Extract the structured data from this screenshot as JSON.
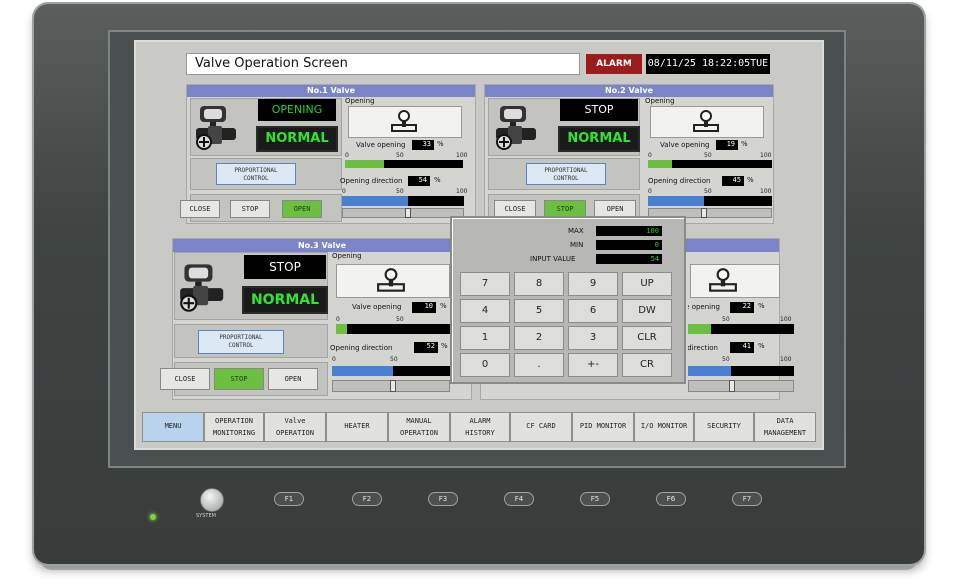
{
  "screen": {
    "title": "Valve Operation Screen",
    "alarm_label": "ALARM",
    "clock": "08/11/25 18:22:05TUE"
  },
  "valves": [
    {
      "title": "No.1 Valve",
      "state": "OPENING",
      "state_color": "#2ed22e",
      "health": "NORMAL",
      "control_label_1": "PROPORTIONAL",
      "control_label_2": "CONTROL",
      "opening_label": "Opening",
      "valve_opening_label": "Valve opening",
      "valve_opening_value": "33",
      "valve_opening_unit": "%",
      "valve_opening_fraction": 0.33,
      "direction_label": "Opening direction",
      "direction_value": "54",
      "direction_unit": "%",
      "direction_fraction": 0.54,
      "scale_min": "0",
      "scale_mid": "50",
      "scale_max": "100",
      "buttons": [
        "CLOSE",
        "STOP",
        "OPEN"
      ],
      "active_button": "OPEN"
    },
    {
      "title": "No.2 Valve",
      "state": "STOP",
      "state_color": "#ffffff",
      "health": "NORMAL",
      "control_label_1": "PROPORTIONAL",
      "control_label_2": "CONTROL",
      "opening_label": "Opening",
      "valve_opening_label": "Valve opening",
      "valve_opening_value": "19",
      "valve_opening_unit": "%",
      "valve_opening_fraction": 0.19,
      "direction_label": "Opening direction",
      "direction_value": "45",
      "direction_unit": "%",
      "direction_fraction": 0.45,
      "scale_min": "0",
      "scale_mid": "50",
      "scale_max": "100",
      "buttons": [
        "CLOSE",
        "STOP",
        "OPEN"
      ],
      "active_button": "STOP"
    },
    {
      "title": "No.3 Valve",
      "state": "STOP",
      "state_color": "#ffffff",
      "health": "NORMAL",
      "control_label_1": "PROPORTIONAL",
      "control_label_2": "CONTROL",
      "opening_label": "Opening",
      "valve_opening_label": "Valve opening",
      "valve_opening_value": "10",
      "valve_opening_unit": "%",
      "valve_opening_fraction": 0.1,
      "direction_label": "Opening direction",
      "direction_value": "52",
      "direction_unit": "%",
      "direction_fraction": 0.52,
      "scale_min": "0",
      "scale_mid": "50",
      "scale_max": "100",
      "buttons": [
        "CLOSE",
        "STOP",
        "OPEN"
      ],
      "active_button": "STOP"
    },
    {
      "title": "",
      "valve_opening_label": "Valve opening",
      "valve_opening_value": "22",
      "valve_opening_unit": "%",
      "valve_opening_fraction": 0.22,
      "direction_label": "Opening direction",
      "direction_value": "41",
      "direction_unit": "%",
      "direction_fraction": 0.41,
      "scale_mid": "50",
      "scale_max": "100"
    }
  ],
  "keypad": {
    "max_label": "MAX",
    "max_value": "100",
    "min_label": "MIN",
    "min_value": "0",
    "input_label": "INPUT VALUE",
    "input_value": "54",
    "keys": [
      "7",
      "8",
      "9",
      "UP",
      "4",
      "5",
      "6",
      "DW",
      "1",
      "2",
      "3",
      "CLR",
      "0",
      ".",
      "+-",
      "CR"
    ]
  },
  "menu": [
    {
      "line1": "MENU",
      "line2": ""
    },
    {
      "line1": "OPERATION",
      "line2": "MONITORING"
    },
    {
      "line1": "Valve",
      "line2": "OPERATION"
    },
    {
      "line1": "HEATER",
      "line2": ""
    },
    {
      "line1": "MANUAL",
      "line2": "OPERATION"
    },
    {
      "line1": "ALARM",
      "line2": "HISTORY"
    },
    {
      "line1": "CF CARD",
      "line2": ""
    },
    {
      "line1": "PID MONITOR",
      "line2": ""
    },
    {
      "line1": "I/O MONITOR",
      "line2": ""
    },
    {
      "line1": "SECURITY",
      "line2": ""
    },
    {
      "line1": "DATA",
      "line2": "MANAGEMENT"
    }
  ],
  "hardware": {
    "system_label": "SYSTEM",
    "fkeys": [
      "F1",
      "F2",
      "F3",
      "F4",
      "F5",
      "F6",
      "F7"
    ]
  }
}
